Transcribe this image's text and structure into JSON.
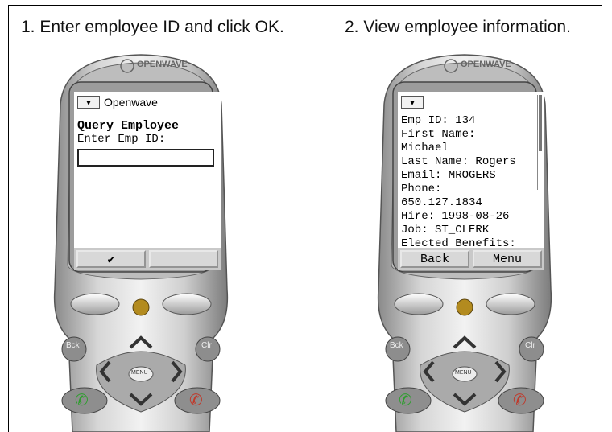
{
  "steps": [
    {
      "title": "1. Enter employee ID and click OK."
    },
    {
      "title": "2. View employee information."
    }
  ],
  "phone": {
    "brand": "OPENWAVE",
    "keys": {
      "back": "Bck",
      "clear": "Clr",
      "menu": "MENU"
    }
  },
  "screen1": {
    "menu_glyph": "▾",
    "app_title": "Openwave",
    "heading": "Query Employee",
    "prompt": "Enter Emp ID:",
    "input_value": "",
    "softkey_left": "✔",
    "softkey_right": ""
  },
  "screen2": {
    "menu_glyph": "▾",
    "lines": [
      "Emp ID: 134",
      "First Name:",
      "Michael",
      "Last Name: Rogers",
      "Email: MROGERS",
      "Phone:",
      "650.127.1834",
      "Hire: 1998-08-26",
      "Job: ST_CLERK",
      "Elected Benefits:"
    ],
    "softkey_left": "Back",
    "softkey_right": "Menu"
  }
}
